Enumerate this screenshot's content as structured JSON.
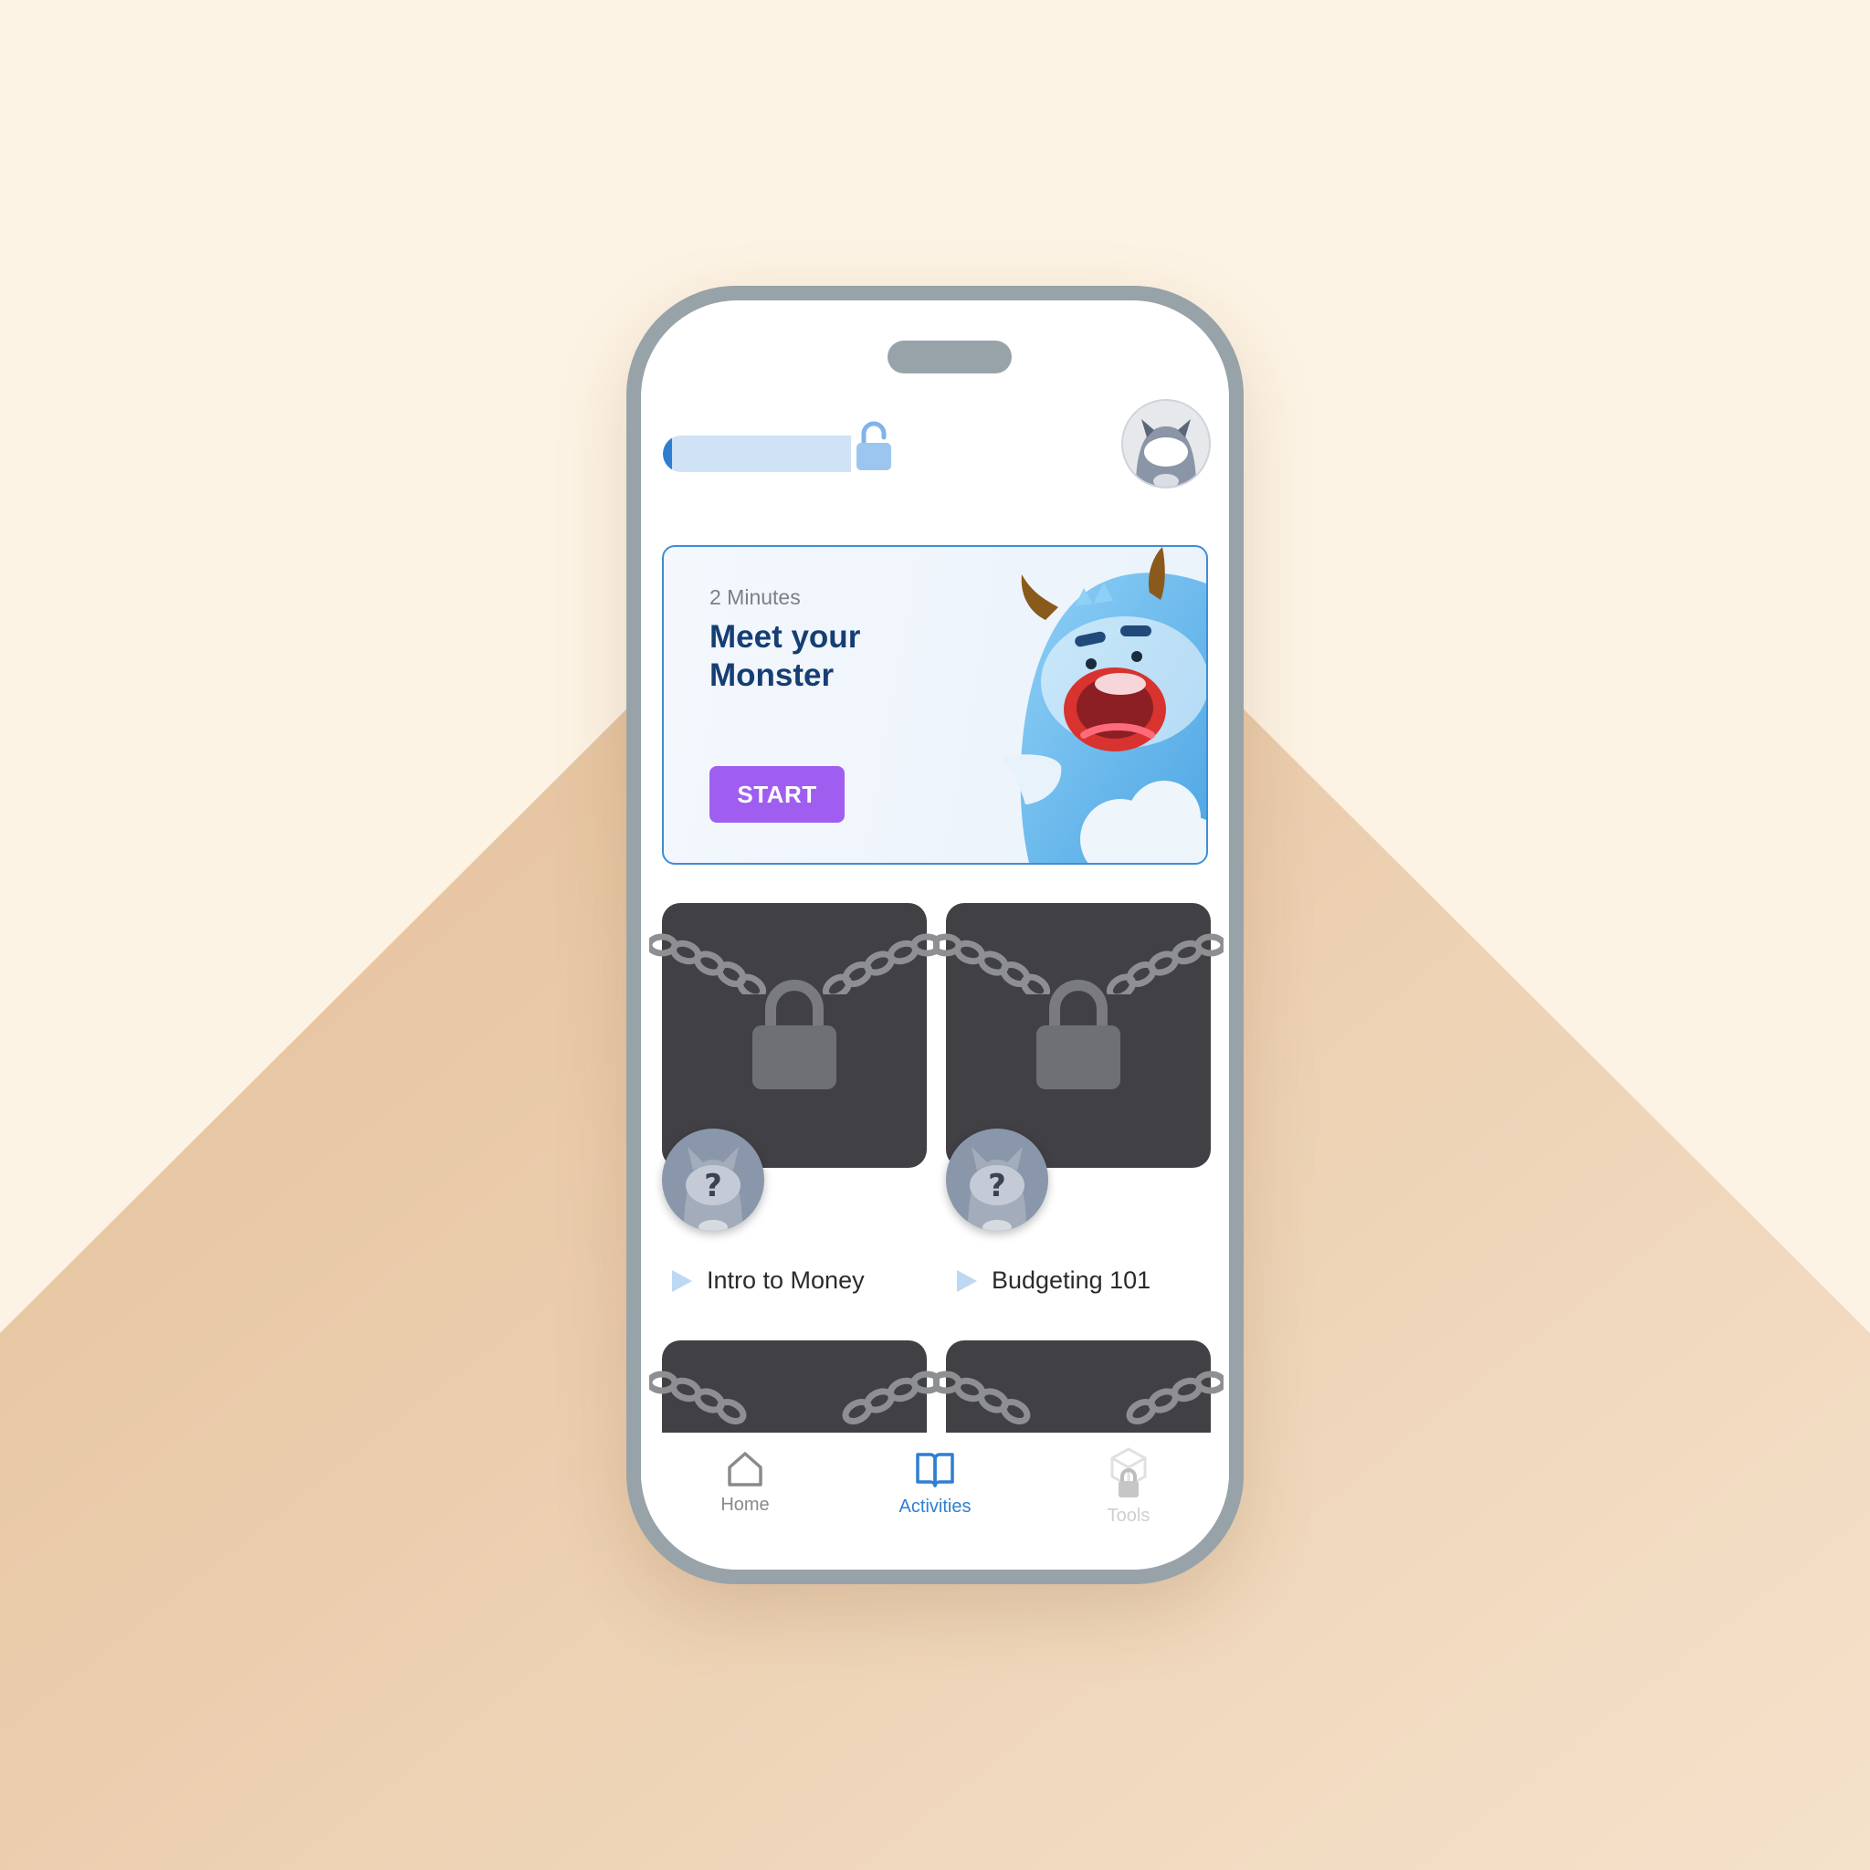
{
  "colors": {
    "bg_light": "#fdf3e4",
    "bg_peach": "#e8c4a0",
    "frame": "#97a3a8",
    "accent_blue": "#2f7fd1",
    "start_purple": "#a05ef0",
    "title_navy": "#153e74"
  },
  "header": {
    "progress": 0.05,
    "progress_icon": "unlocked-padlock-icon",
    "avatar_icon": "monster-avatar-icon"
  },
  "hero": {
    "duration": "2 Minutes",
    "title": "Meet your Monster",
    "start_label": "START",
    "illustration": "blue-monster-illustration"
  },
  "activities": [
    {
      "title": "Intro to Money",
      "locked": true,
      "badge": "?"
    },
    {
      "title": "Budgeting 101",
      "locked": true,
      "badge": "?"
    },
    {
      "title": "",
      "locked": true
    },
    {
      "title": "",
      "locked": true
    }
  ],
  "nav": {
    "home": {
      "label": "Home",
      "icon": "home-icon"
    },
    "activities": {
      "label": "Activities",
      "icon": "book-icon",
      "active": true
    },
    "tools": {
      "label": "Tools",
      "icon": "locked-tools-icon",
      "disabled": true
    }
  }
}
